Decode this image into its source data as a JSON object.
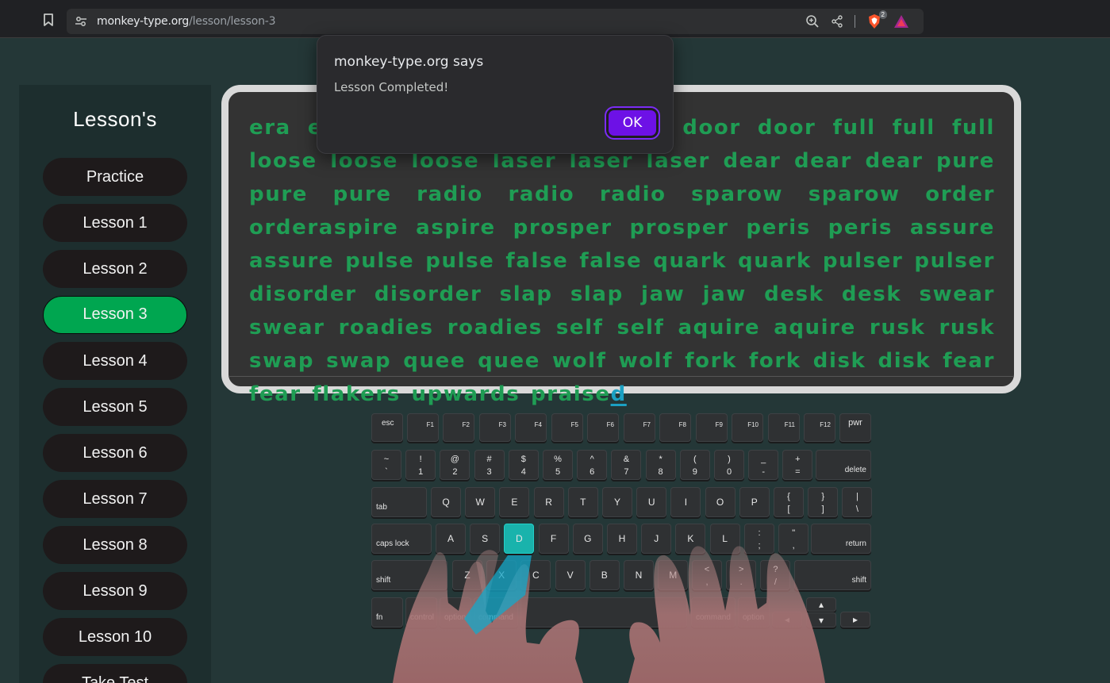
{
  "browser": {
    "url_host": "monkey-type.org",
    "url_path": "/lesson/lesson-3",
    "extension_badge": "2"
  },
  "sidebar": {
    "title": "Lesson's",
    "items": [
      {
        "label": "Practice"
      },
      {
        "label": "Lesson 1"
      },
      {
        "label": "Lesson 2"
      },
      {
        "label": "Lesson 3",
        "active": true
      },
      {
        "label": "Lesson 4"
      },
      {
        "label": "Lesson 5"
      },
      {
        "label": "Lesson 6"
      },
      {
        "label": "Lesson 7"
      },
      {
        "label": "Lesson 8"
      },
      {
        "label": "Lesson 9"
      },
      {
        "label": "Lesson 10"
      },
      {
        "label": "Take Test"
      }
    ]
  },
  "typing": {
    "text_main": "era era era sea sea sea door door door full full full loose loose loose laser laser laser dear dear dear pure pure pure radio radio radio sparow sparow order orderaspire aspire prosper prosper peris peris assure assure pulse pulse false false quark quark pulser pulser disorder disorder slap slap jaw jaw desk desk swear swear roadies roadies self self aquire aquire rusk rusk swap swap quee quee wolf wolf fork fork disk disk fear fear flakers upwards praise",
    "current_char": "d"
  },
  "dialog": {
    "title": "monkey-type.org says",
    "message": "Lesson Completed!",
    "ok_label": "OK"
  },
  "keyboard": {
    "fn_row": [
      "esc",
      "F1",
      "F2",
      "F3",
      "F4",
      "F5",
      "F6",
      "F7",
      "F8",
      "F9",
      "F10",
      "F11",
      "F12",
      "pwr"
    ],
    "number_row": [
      {
        "up": "~",
        "down": "`"
      },
      {
        "up": "!",
        "down": "1"
      },
      {
        "up": "@",
        "down": "2"
      },
      {
        "up": "#",
        "down": "3"
      },
      {
        "up": "$",
        "down": "4"
      },
      {
        "up": "%",
        "down": "5"
      },
      {
        "up": "^",
        "down": "6"
      },
      {
        "up": "&",
        "down": "7"
      },
      {
        "up": "*",
        "down": "8"
      },
      {
        "up": "(",
        "down": "9"
      },
      {
        "up": ")",
        "down": "0"
      },
      {
        "up": "_",
        "down": "-"
      },
      {
        "up": "+",
        "down": "="
      }
    ],
    "delete": "delete",
    "tab": "tab",
    "qwerty_row": [
      "Q",
      "W",
      "E",
      "R",
      "T",
      "Y",
      "U",
      "I",
      "O",
      "P"
    ],
    "bracket_keys": [
      {
        "up": "{",
        "down": "["
      },
      {
        "up": "}",
        "down": "]"
      },
      {
        "up": "|",
        "down": "\\"
      }
    ],
    "caps": "caps lock",
    "home_row": [
      "A",
      "S",
      "D",
      "F",
      "G",
      "H",
      "J",
      "K",
      "L"
    ],
    "home_punct": [
      {
        "up": ":",
        "down": ";"
      },
      {
        "up": "\"",
        "down": ","
      }
    ],
    "return": "return",
    "shift": "shift",
    "bottom_letters": [
      "Z",
      "X",
      "C",
      "V",
      "B",
      "N",
      "M"
    ],
    "bottom_punct": [
      {
        "up": "<",
        "down": ","
      },
      {
        "up": ">",
        "down": "."
      },
      {
        "up": "?",
        "down": "/"
      }
    ],
    "space_row": [
      "fn",
      "control",
      "option",
      "command",
      "command",
      "option"
    ],
    "arrows": {
      "left": "◂",
      "up": "▴",
      "down": "▾",
      "right": "▸"
    },
    "highlighted_key": "D"
  },
  "colors": {
    "accent_green": "#00a650",
    "typed_text": "#1f9d54",
    "cursor": "#1ba0c2",
    "dialog_button": "#6d11e6",
    "highlight_key": "#19b3ac"
  }
}
